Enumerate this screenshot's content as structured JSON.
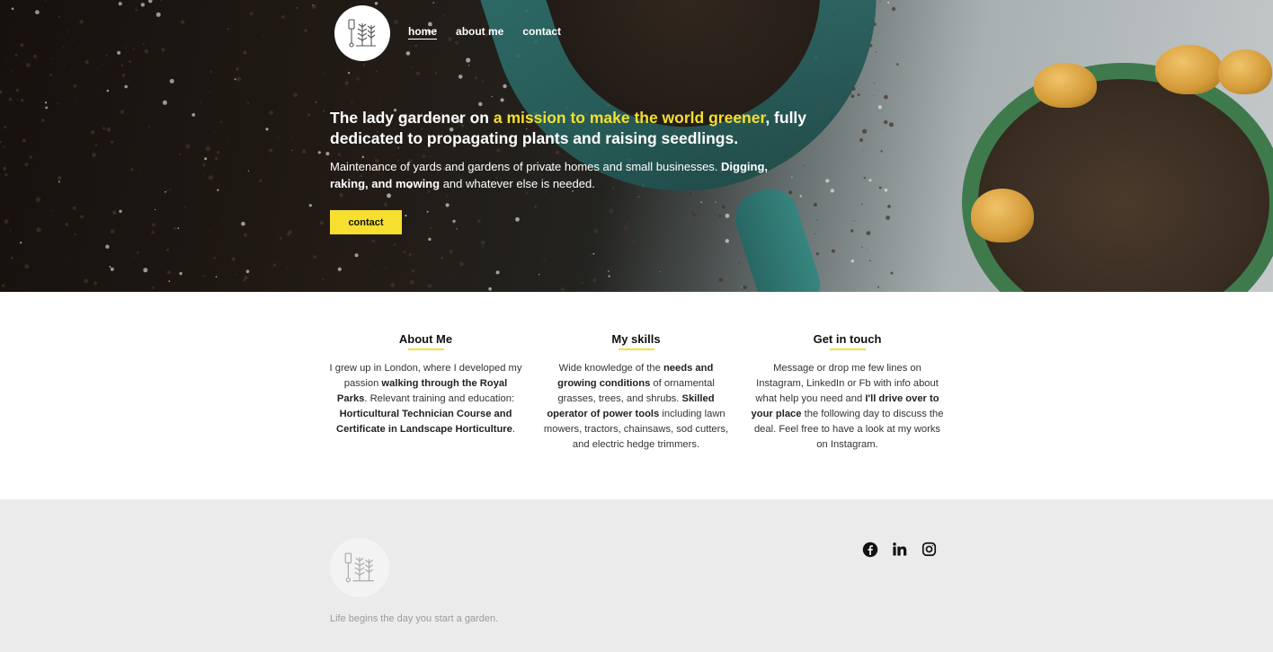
{
  "nav": {
    "links": [
      "home",
      "about me",
      "contact"
    ],
    "active": "home"
  },
  "hero": {
    "headline_start": "The lady gardener on ",
    "headline_accent": "a mission to make the world greener",
    "headline_end": ", fully dedicated to propagating plants and raising seedlings.",
    "lead_start": "Maintenance of yards and gardens of private homes and small businesses. ",
    "lead_bold": "Digging, raking, and mowing",
    "lead_end": " and whatever else is needed.",
    "cta_label": "contact"
  },
  "columns": [
    {
      "title": "About Me",
      "parts": [
        {
          "t": "I grew up in London, where I developed my passion ",
          "b": false
        },
        {
          "t": "walking through the Royal Parks",
          "b": true
        },
        {
          "t": ". Relevant training and education: ",
          "b": false
        },
        {
          "t": "Horticultural Technician Course and Certificate in Landscape Horticulture",
          "b": true
        },
        {
          "t": ".",
          "b": false
        }
      ]
    },
    {
      "title": "My skills",
      "parts": [
        {
          "t": "Wide knowledge of the ",
          "b": false
        },
        {
          "t": "needs and growing conditions",
          "b": true
        },
        {
          "t": " of ornamental grasses, trees, and shrubs. ",
          "b": false
        },
        {
          "t": "Skilled operator of power tools",
          "b": true
        },
        {
          "t": " including lawn mowers, tractors, chainsaws, sod cutters, and electric hedge trimmers.",
          "b": false
        }
      ]
    },
    {
      "title": "Get in touch",
      "parts": [
        {
          "t": "Message or drop me few lines on Instagram, LinkedIn or Fb with info about what help you need and ",
          "b": false
        },
        {
          "t": "I'll drive over to your place",
          "b": true
        },
        {
          "t": " the following day to discuss the deal. Feel free to have a look at my works on Instagram.",
          "b": false
        }
      ]
    }
  ],
  "footer": {
    "tagline": "Life begins the day you start a garden.",
    "socials": [
      "facebook-icon",
      "linkedin-icon",
      "instagram-icon"
    ]
  },
  "colors": {
    "accent": "#f7df2f",
    "footer_bg": "#ebebeb"
  }
}
